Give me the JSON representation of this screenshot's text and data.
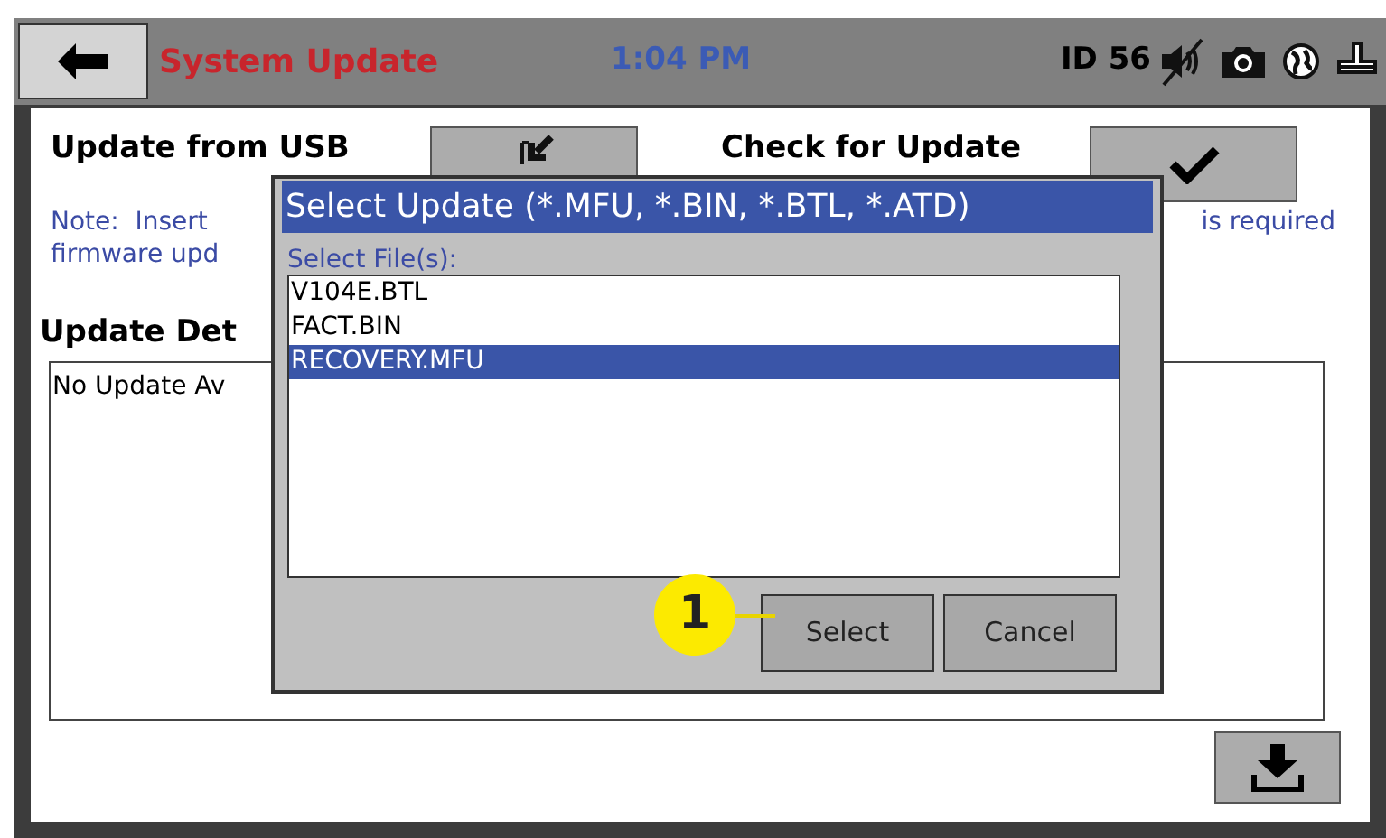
{
  "header": {
    "title": "System Update",
    "time": "1:04 PM",
    "device_id": "ID 56"
  },
  "usb": {
    "label": "Update from USB"
  },
  "check": {
    "label": "Check for Update"
  },
  "note": {
    "left": "Note:  Insert",
    "right": "is required",
    "second_line": "firmware upd"
  },
  "details": {
    "heading": "Update Det",
    "text": "No Update Av"
  },
  "dialog": {
    "title": "Select Update (*.MFU, *.BIN, *.BTL, *.ATD)",
    "list_label": "Select File(s):",
    "files": [
      {
        "name": "V104E.BTL",
        "selected": false
      },
      {
        "name": "FACT.BIN",
        "selected": false
      },
      {
        "name": "RECOVERY.MFU",
        "selected": true
      }
    ],
    "buttons": [
      "Select",
      "Cancel"
    ]
  },
  "callout": {
    "number": "1"
  }
}
